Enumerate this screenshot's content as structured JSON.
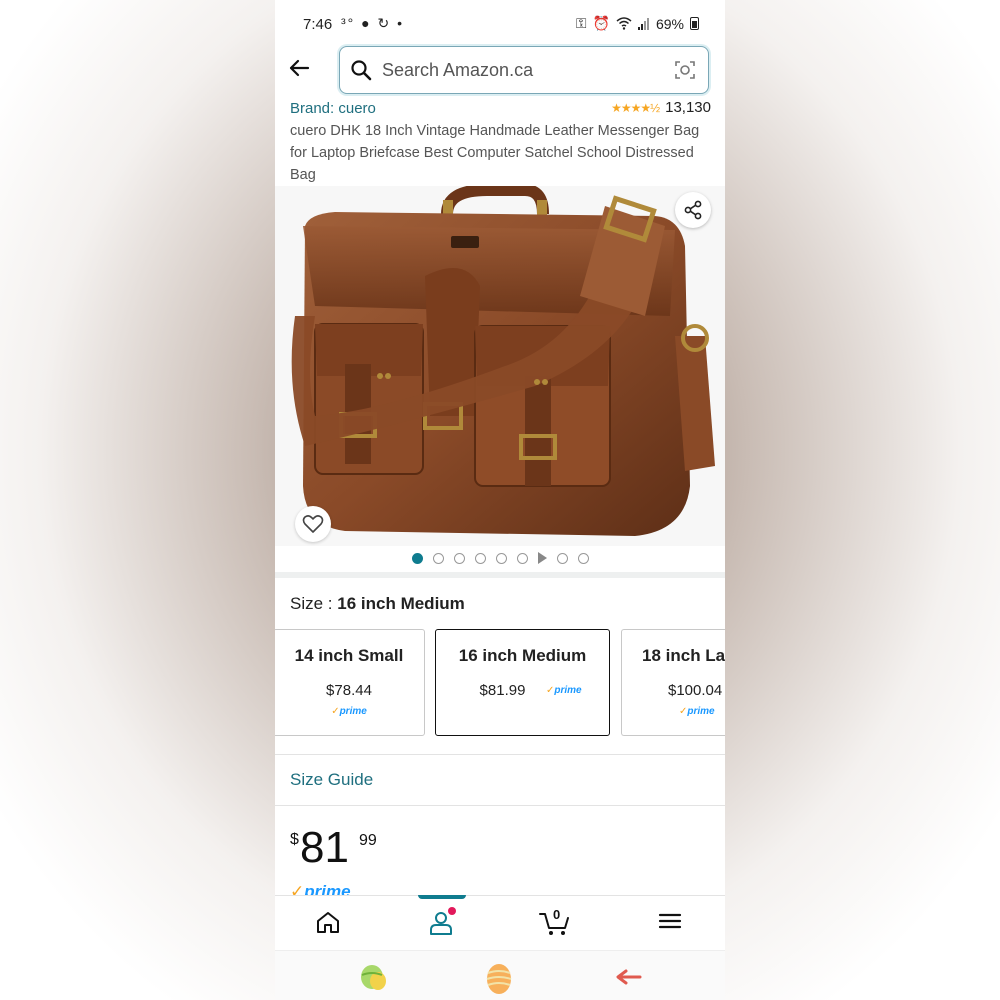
{
  "status_bar": {
    "time": "7:46",
    "left_icons": "³° ● ↻ •",
    "battery": "69%"
  },
  "search": {
    "placeholder": "Search Amazon.ca"
  },
  "product": {
    "brand": "Brand: cuero",
    "stars": "★★★★½",
    "rating_count": "13,130",
    "title": "cuero DHK 18 Inch Vintage Handmade Leather Messenger Bag for Laptop Briefcase Best Computer Satchel School Distressed Bag",
    "rating_value_stars": 4.5
  },
  "gallery": {
    "dot_count": 9,
    "active_index": 0,
    "video_index": 6
  },
  "size": {
    "label": "Size :",
    "selected": "16 inch Medium",
    "options": [
      {
        "name": "14 inch Small",
        "price": "$78.44",
        "prime": "prime"
      },
      {
        "name": "16 inch Medium",
        "price": "$81.99",
        "prime": "prime"
      },
      {
        "name": "18 inch La",
        "price": "$100.04",
        "prime": "prime"
      }
    ],
    "guide": "Size Guide"
  },
  "price": {
    "currency": "$",
    "whole": "81",
    "fraction": "99",
    "prime": "prime"
  },
  "nav": {
    "cart_count": "0"
  },
  "colors": {
    "accent": "#0f7c8f",
    "link": "#1f6f7f",
    "prime": "#1a98ff",
    "star": "#f6a623"
  }
}
